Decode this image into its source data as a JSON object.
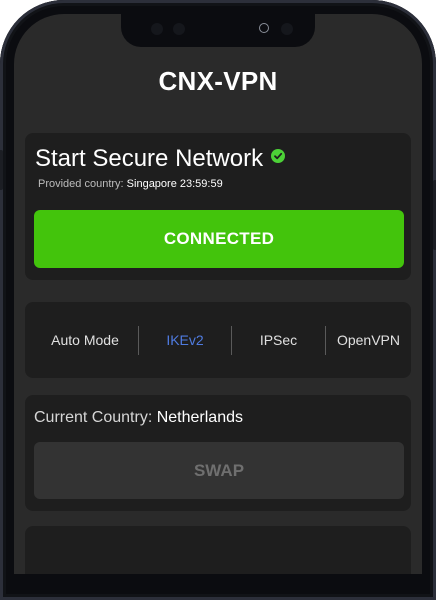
{
  "app": {
    "title": "CNX-VPN"
  },
  "status": {
    "title": "Start Secure Network",
    "provided_label": "Provided country:",
    "provided_value": "Singapore 23:59:59",
    "connect_label": "CONNECTED",
    "connected_color": "#43c40c"
  },
  "modes": {
    "items": [
      {
        "label": "Auto Mode",
        "active": false
      },
      {
        "label": "IKEv2",
        "active": true
      },
      {
        "label": "IPSec",
        "active": false
      },
      {
        "label": "OpenVPN",
        "active": false
      }
    ],
    "active_color": "#4f7be0"
  },
  "country": {
    "label": "Current Country:",
    "value": "Netherlands",
    "swap_label": "SWAP"
  },
  "icons": {
    "status_check": "check-circle-icon"
  }
}
